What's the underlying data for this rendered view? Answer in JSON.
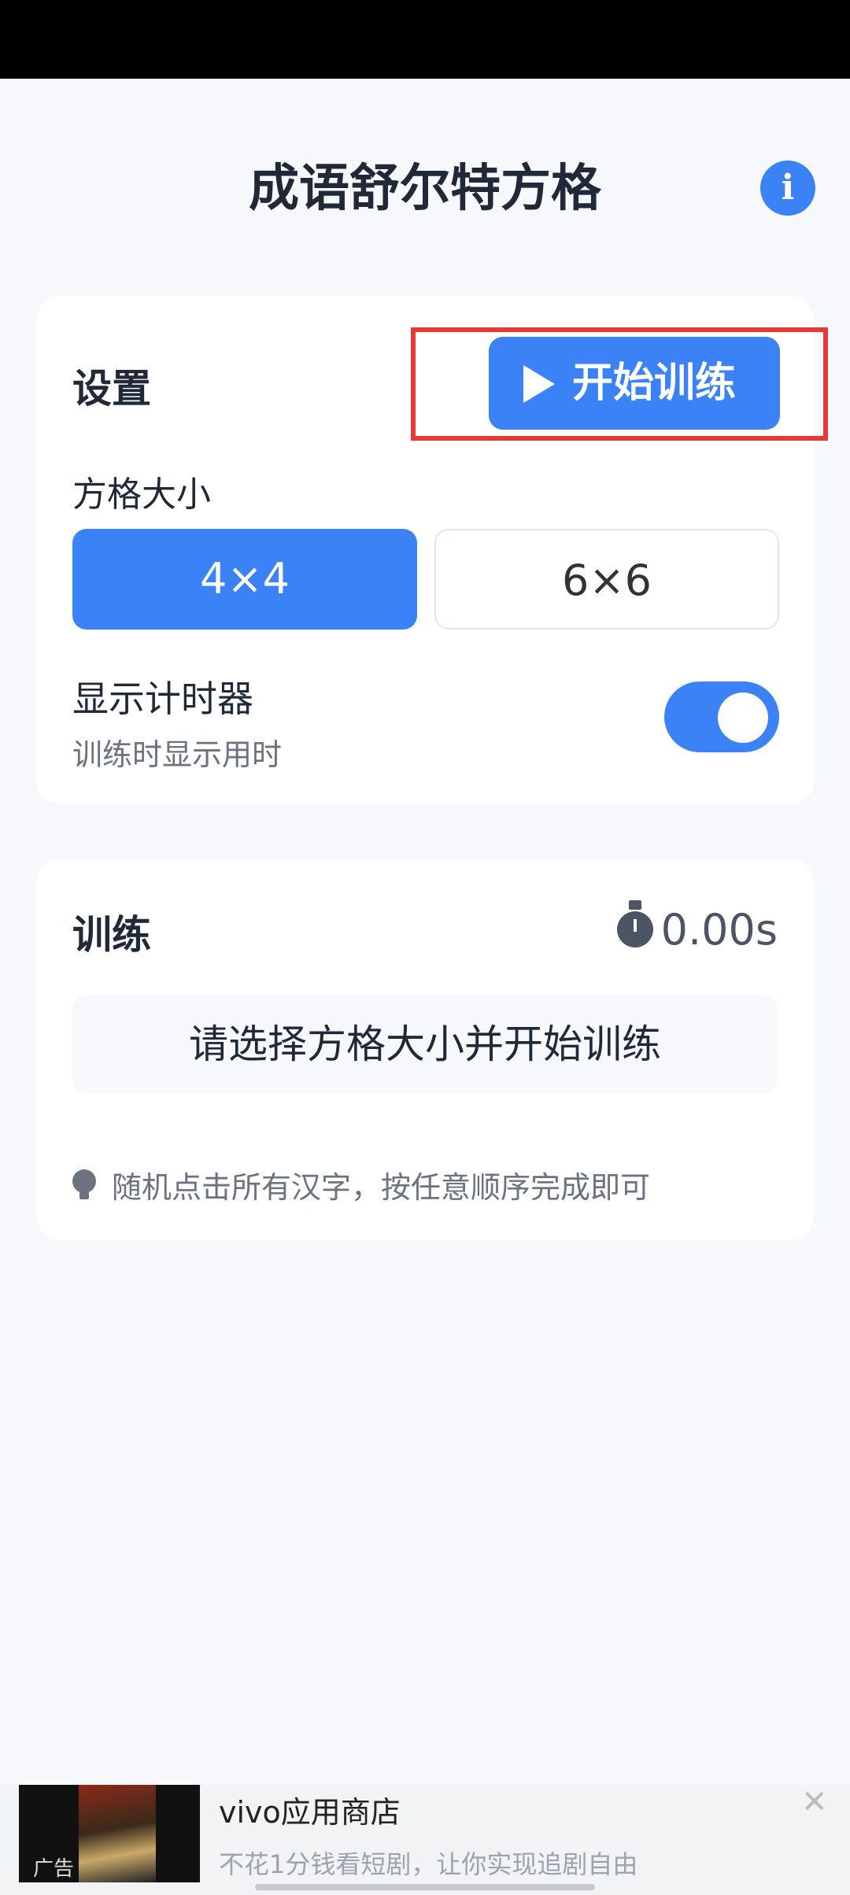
{
  "app": {
    "title": "成语舒尔特方格",
    "info_icon": "i"
  },
  "settings": {
    "label": "设置",
    "start_button": "开始训练",
    "grid_size_label": "方格大小",
    "grid_options": [
      "4×4",
      "6×6"
    ],
    "selected_grid": "4×4",
    "timer_label": "显示计时器",
    "timer_desc": "训练时显示用时",
    "timer_enabled": true
  },
  "training": {
    "label": "训练",
    "time": "0.00s",
    "prompt": "请选择方格大小并开始训练",
    "hint": "随机点击所有汉字，按任意顺序完成即可"
  },
  "ad": {
    "badge": "广告",
    "title": "vivo应用商店",
    "desc": "不花1分钱看短剧，让你实现追剧自由",
    "close": "✕"
  },
  "colors": {
    "accent": "#3b82f6",
    "highlight": "#e53935"
  }
}
